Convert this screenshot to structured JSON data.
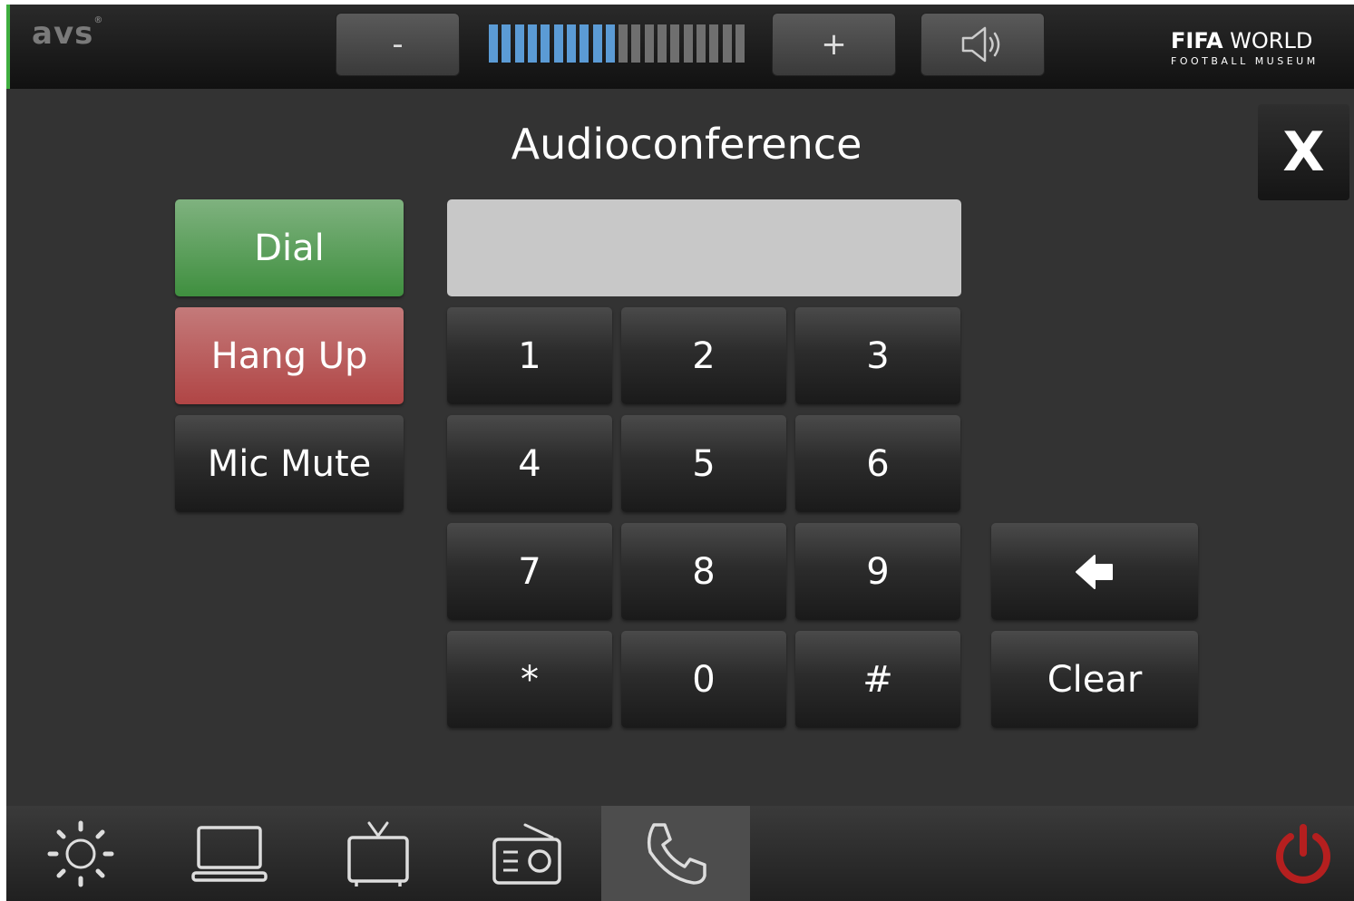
{
  "branding": {
    "logo_text": "avs",
    "logo_mark": "®",
    "partner_bold": "FIFA",
    "partner_light": " WORLD",
    "partner_sub": "FOOTBALL MUSEUM"
  },
  "volume": {
    "down_label": "-",
    "up_label": "+",
    "level": 0.5,
    "segments": 20,
    "speaker_icon": "speaker-icon"
  },
  "page": {
    "title": "Audioconference",
    "close_label": "X"
  },
  "controls": {
    "dial_label": "Dial",
    "hangup_label": "Hang Up",
    "mute_label": "Mic Mute"
  },
  "number_field": {
    "value": "",
    "placeholder": ""
  },
  "keypad": {
    "keys": [
      "1",
      "2",
      "3",
      "4",
      "5",
      "6",
      "7",
      "8",
      "9",
      "*",
      "0",
      "#"
    ],
    "backspace_icon": "arrow-left-icon",
    "clear_label": "Clear"
  },
  "colors": {
    "accent_green": "#4a9a4a",
    "hangup_red": "#b75353",
    "volume_on": "#5b9bd5",
    "power_red": "#b51f1f"
  },
  "nav": {
    "items": [
      "brightness-icon",
      "laptop-icon",
      "tv-icon",
      "radio-icon",
      "phone-icon"
    ],
    "active": "phone-icon",
    "power_icon": "power-icon"
  }
}
